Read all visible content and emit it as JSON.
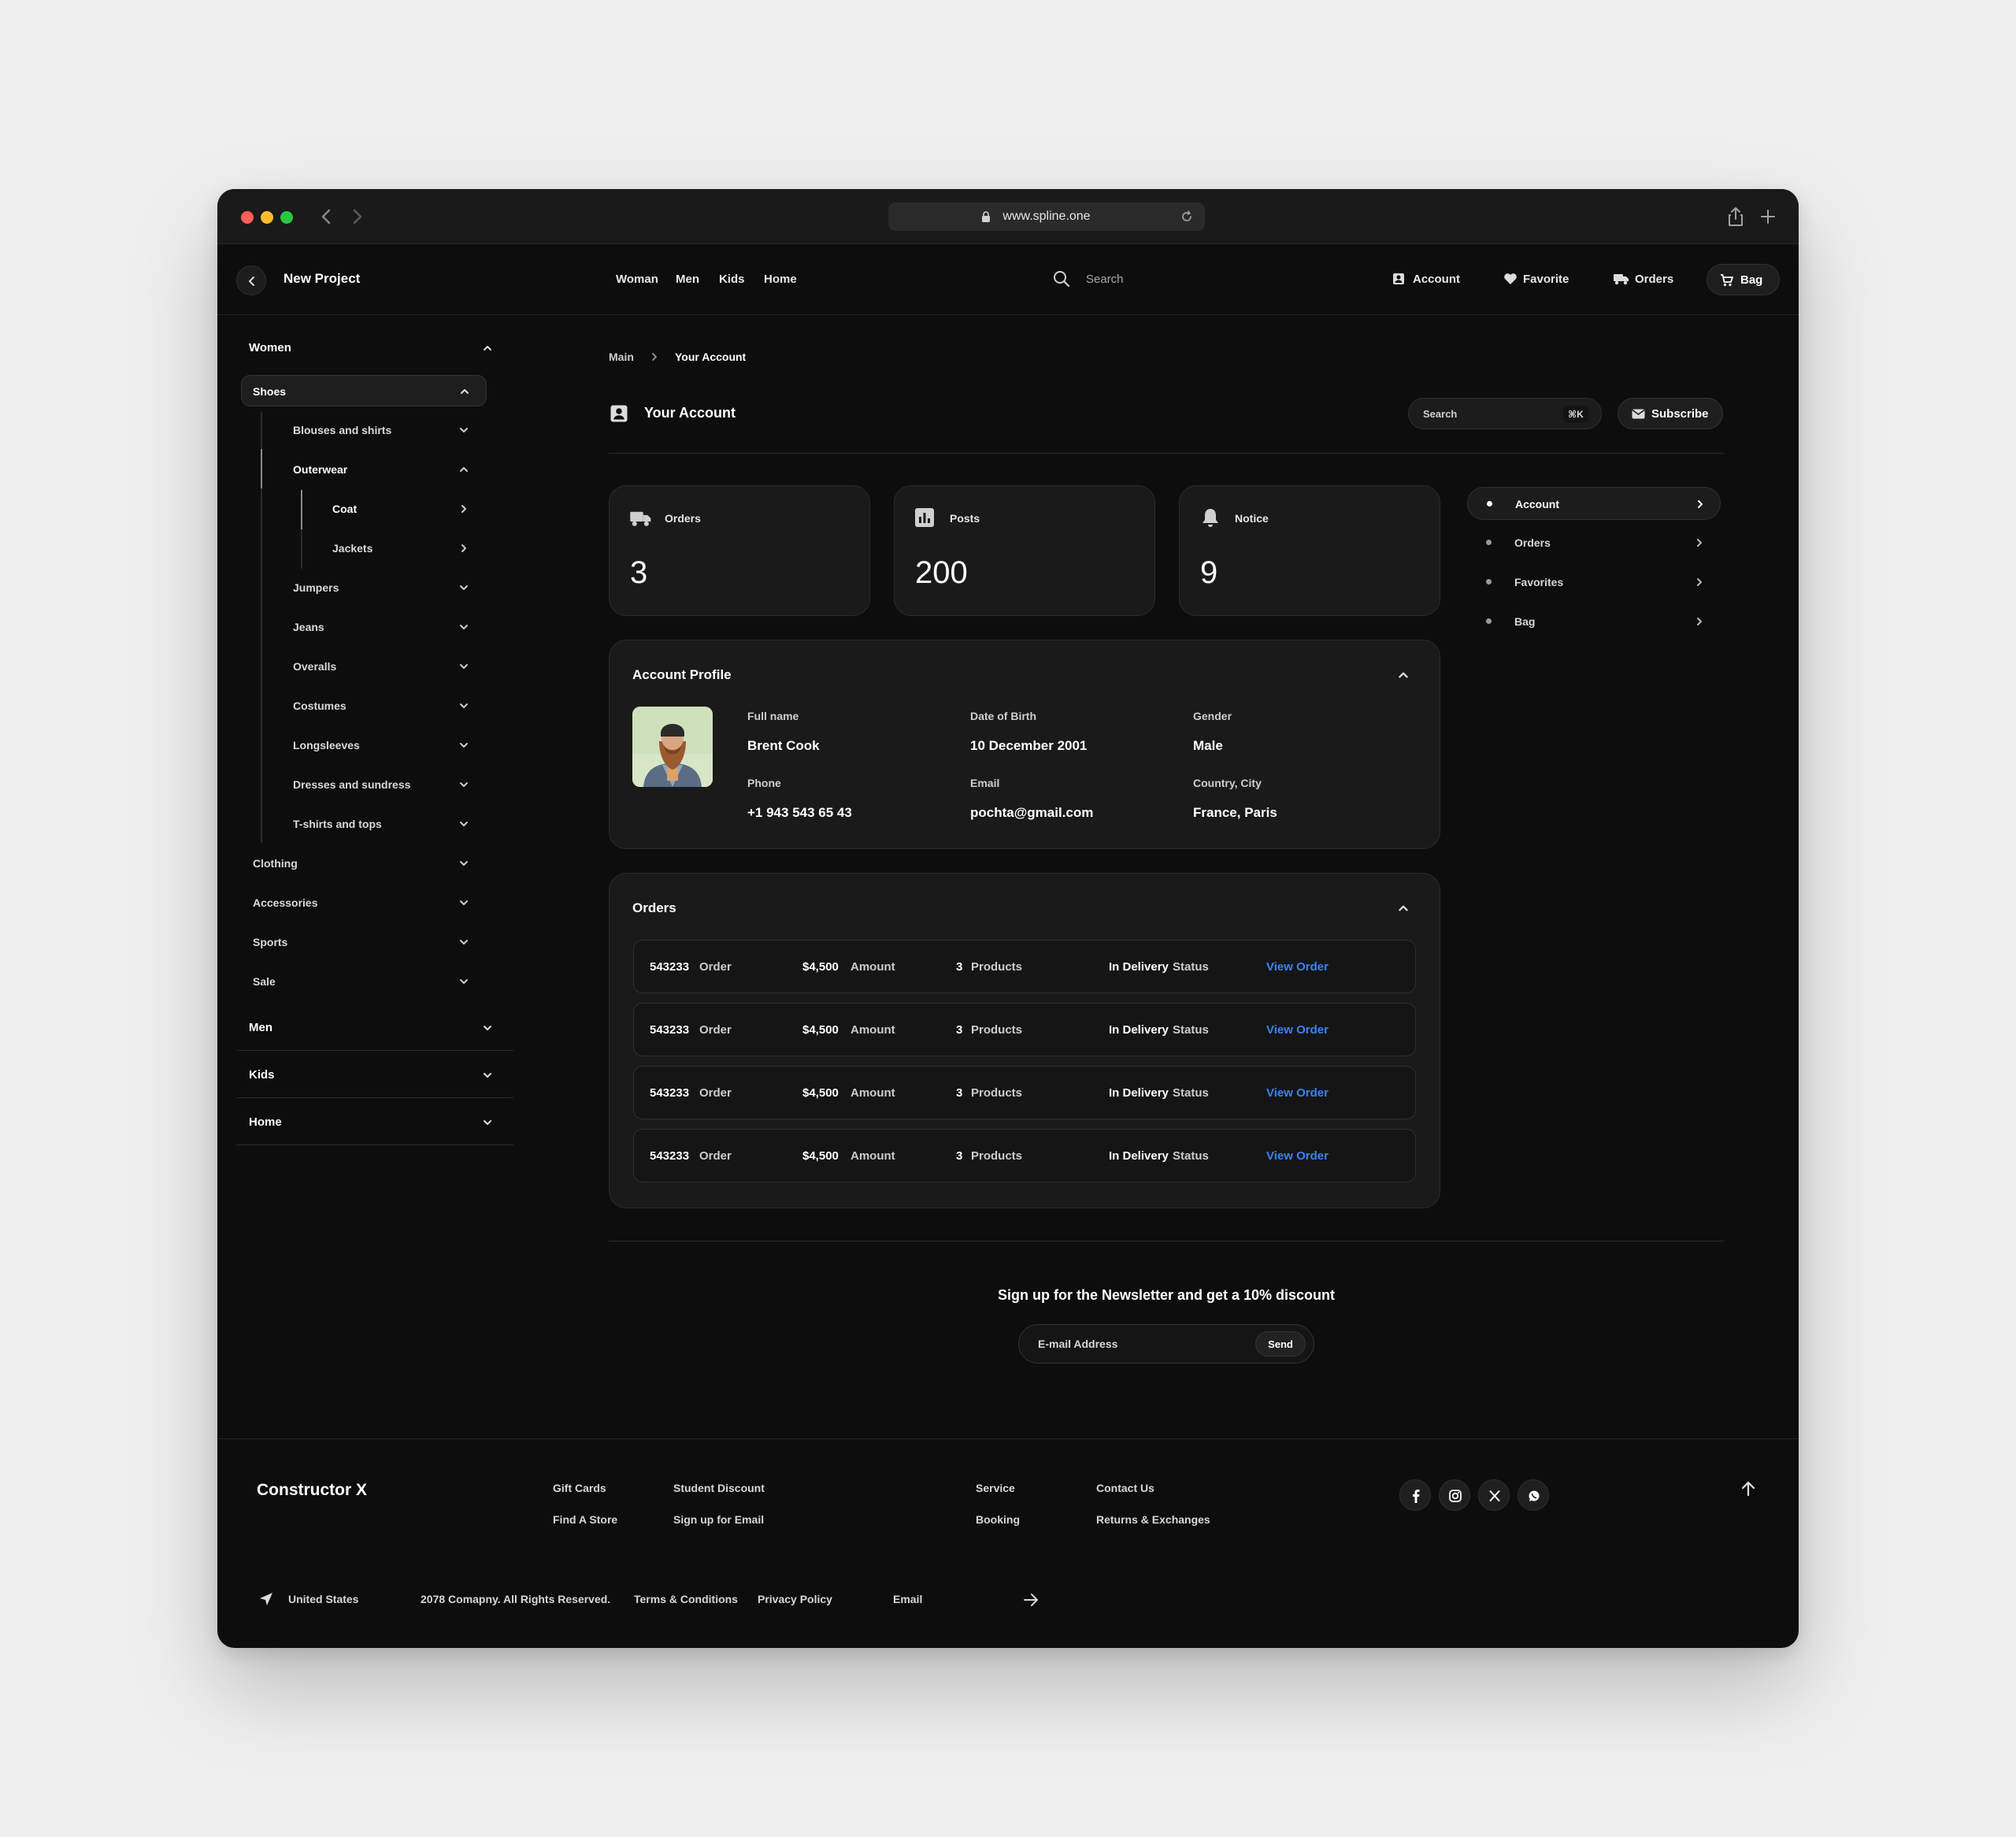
{
  "browser": {
    "url": "www.spline.one",
    "dots": [
      "#ff5f57",
      "#febc2e",
      "#28c840"
    ]
  },
  "header": {
    "project": "New Project",
    "nav": [
      "Woman",
      "Men",
      "Kids",
      "Home"
    ],
    "search_placeholder": "Search",
    "account": "Account",
    "favorite": "Favorite",
    "orders": "Orders",
    "bag": "Bag"
  },
  "sidebar": {
    "women": "Women",
    "shoes": "Shoes",
    "blouses": "Blouses and shirts",
    "outerwear": "Outerwear",
    "coat": "Coat",
    "jackets": "Jackets",
    "subitems": [
      "Jumpers",
      "Jeans",
      "Overalls",
      "Costumes",
      "Longsleeves",
      "Dresses and sundress",
      "T-shirts and tops"
    ],
    "categories": [
      "Clothing",
      "Accessories",
      "Sports",
      "Sale"
    ],
    "sections": [
      "Men",
      "Kids",
      "Home"
    ]
  },
  "breadcrumb": {
    "main": "Main",
    "current": "Your Account"
  },
  "page": {
    "title": "Your Account",
    "search_placeholder": "Search",
    "shortcut": "⌘K",
    "subscribe": "Subscribe"
  },
  "stats": [
    {
      "label": "Orders",
      "value": "3",
      "icon": "truck-icon"
    },
    {
      "label": "Posts",
      "value": "200",
      "icon": "chart-icon"
    },
    {
      "label": "Notice",
      "value": "9",
      "icon": "bell-icon"
    }
  ],
  "profile": {
    "title": "Account Profile",
    "fields": [
      {
        "label": "Full name",
        "value": "Brent Cook"
      },
      {
        "label": "Date of Birth",
        "value": "10 December 2001"
      },
      {
        "label": "Gender",
        "value": "Male"
      },
      {
        "label": "Phone",
        "value": "+1 943 543 65 43"
      },
      {
        "label": "Email",
        "value": "pochta@gmail.com"
      },
      {
        "label": "Country, City",
        "value": "France, Paris"
      }
    ]
  },
  "orders": {
    "title": "Orders",
    "rows": [
      {
        "id": "543233",
        "id_label": "Order",
        "amount": "$4,500",
        "amount_label": "Amount",
        "products": "3",
        "products_label": "Products",
        "status": "In Delivery",
        "status_label": "Status",
        "link": "View Order"
      },
      {
        "id": "543233",
        "id_label": "Order",
        "amount": "$4,500",
        "amount_label": "Amount",
        "products": "3",
        "products_label": "Products",
        "status": "In Delivery",
        "status_label": "Status",
        "link": "View Order"
      },
      {
        "id": "543233",
        "id_label": "Order",
        "amount": "$4,500",
        "amount_label": "Amount",
        "products": "3",
        "products_label": "Products",
        "status": "In Delivery",
        "status_label": "Status",
        "link": "View Order"
      },
      {
        "id": "543233",
        "id_label": "Order",
        "amount": "$4,500",
        "amount_label": "Amount",
        "products": "3",
        "products_label": "Products",
        "status": "In Delivery",
        "status_label": "Status",
        "link": "View Order"
      }
    ]
  },
  "right_menu": [
    "Account",
    "Orders",
    "Favorites",
    "Bag"
  ],
  "newsletter": {
    "title": "Sign up for the Newsletter and get a 10% discount",
    "placeholder": "E-mail Address",
    "send": "Send"
  },
  "footer": {
    "brand": "Constructor X",
    "col1": [
      "Gift Cards",
      "Find A Store"
    ],
    "col2": [
      "Student Discount",
      "Sign up for Email"
    ],
    "col3": [
      "Service",
      "Booking"
    ],
    "col4": [
      "Contact Us",
      "Returns & Exchanges"
    ],
    "country": "United States",
    "copyright": "2078 Comapny. All Rights Reserved.",
    "terms": "Terms & Conditions",
    "privacy": "Privacy Policy",
    "email_label": "Email"
  },
  "colors": {
    "accent_link": "#3b82f6",
    "bg": "#0d0d0d",
    "card": "#1a1a1a"
  }
}
